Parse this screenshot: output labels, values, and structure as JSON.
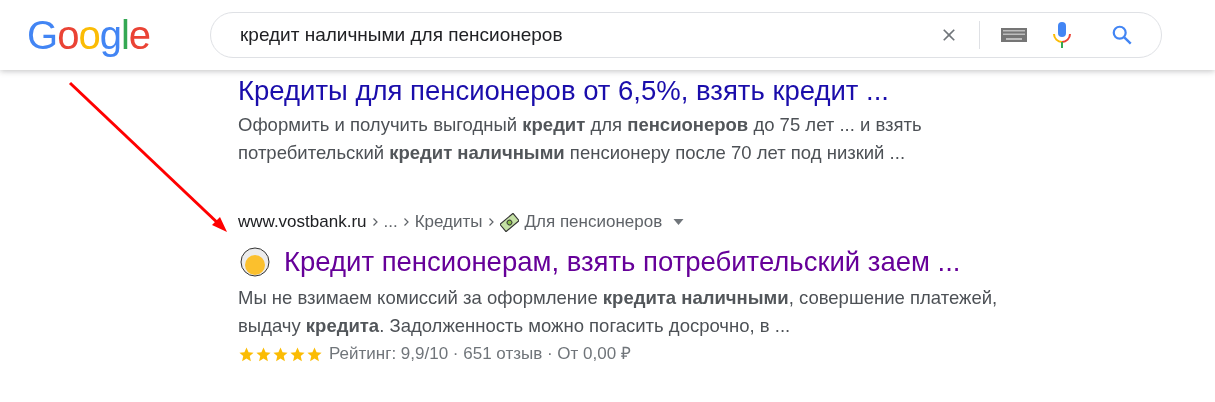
{
  "logo": {
    "letters": [
      {
        "text": "G",
        "color": "#4285f4"
      },
      {
        "text": "o",
        "color": "#ea4335"
      },
      {
        "text": "o",
        "color": "#fbbc05"
      },
      {
        "text": "g",
        "color": "#4285f4"
      },
      {
        "text": "l",
        "color": "#34a853"
      },
      {
        "text": "e",
        "color": "#ea4335"
      }
    ]
  },
  "search": {
    "value": "кредит наличными для пенсионеров"
  },
  "results": [
    {
      "kind": "plain",
      "title": "Кредиты для пенсионеров от 6,5%, взять кредит ...",
      "visited": false,
      "snippet": "Оформить и получить выгодный **кредит** для **пенсионеров** до 75 лет ... и взять потребительский **кредит наличными** пенсионеру после 70 лет под низкий ..."
    },
    {
      "kind": "rich",
      "breadcrumb": {
        "site": "www.vostbank.ru",
        "parts": [
          "...",
          "Кредиты",
          "Для пенсионеров"
        ]
      },
      "title": "Кредит пенсионерам, взять потребительский заем ...",
      "visited": true,
      "snippet": "Мы не взимаем комиссий за оформление **кредита наличными**, совершение платежей, выдачу **кредита**. Задолженность можно погасить досрочно, в ...",
      "stars": 5,
      "rating": "Рейтинг: 9,9/10 · 651 отзыв · От 0,00 ₽"
    }
  ]
}
